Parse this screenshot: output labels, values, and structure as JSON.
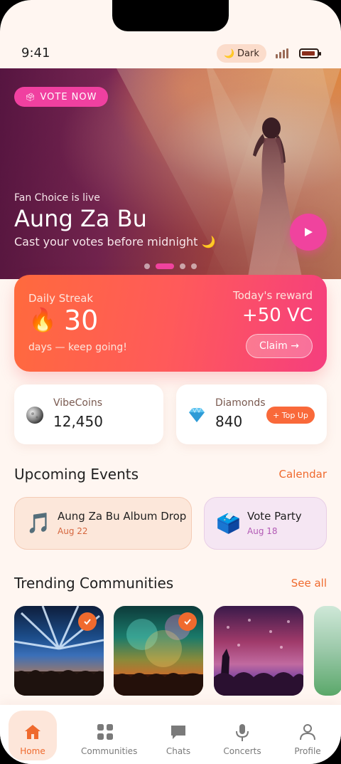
{
  "status": {
    "time": "9:41",
    "theme_label": "Dark",
    "theme_icon": "moon-icon"
  },
  "hero": {
    "badge_label": "VOTE NOW",
    "badge_icon": "ballot-box-icon",
    "subtitle": "Fan Choice is live",
    "title": "Aung Za Bu",
    "tagline": "Cast your votes before midnight 🌙",
    "carousel_active_index": 1,
    "carousel_count": 4
  },
  "streak": {
    "label": "Daily Streak",
    "count": "30",
    "caption": "days — keep going!",
    "reward_label": "Today's reward",
    "reward_value": "+50 VC",
    "claim_label": "Claim →"
  },
  "wallet": {
    "coins": {
      "label": "VibeCoins",
      "value": "12,450",
      "icon": "coin-icon"
    },
    "diamonds": {
      "label": "Diamonds",
      "value": "840",
      "icon": "diamond-icon",
      "action": "+ Top Up"
    }
  },
  "events": {
    "title": "Upcoming Events",
    "link": "Calendar",
    "items": [
      {
        "name": "Aung Za Bu Album Drop",
        "date": "Aug 22",
        "icon": "music-note-icon"
      },
      {
        "name": "Vote Party",
        "date": "Aug 18",
        "icon": "ballot-box-icon"
      }
    ]
  },
  "communities": {
    "title": "Trending Communities",
    "link": "See all"
  },
  "nav": {
    "items": [
      {
        "label": "Home",
        "icon": "home-icon",
        "active": true
      },
      {
        "label": "Communities",
        "icon": "grid-icon"
      },
      {
        "label": "Chats",
        "icon": "chat-icon"
      },
      {
        "label": "Concerts",
        "icon": "microphone-icon"
      },
      {
        "label": "Profile",
        "icon": "user-icon"
      }
    ]
  },
  "colors": {
    "accent": "#EF6A2E",
    "pink": "#F0439E",
    "background": "#FFF6F1"
  }
}
